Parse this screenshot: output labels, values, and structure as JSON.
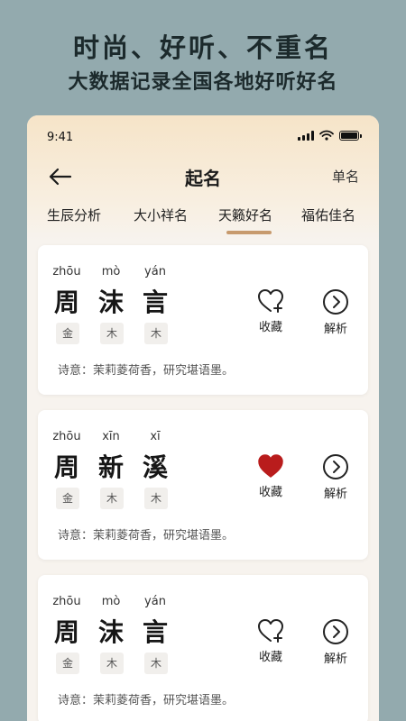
{
  "promo": {
    "title": "时尚、好听、不重名",
    "subtitle": "大数据记录全国各地好听好名"
  },
  "status_bar": {
    "time": "9:41"
  },
  "nav": {
    "title": "起名",
    "right_label": "单名"
  },
  "tabs": [
    {
      "label": "生辰分析"
    },
    {
      "label": "大小祥名"
    },
    {
      "label": "天籁好名",
      "active": true
    },
    {
      "label": "福佑佳名"
    }
  ],
  "colors": {
    "accent": "#c79a6d",
    "favorite_active": "#b91c1c"
  },
  "names": [
    {
      "chars": [
        {
          "pinyin": "zhōu",
          "hanzi": "周",
          "element": "金"
        },
        {
          "pinyin": "mò",
          "hanzi": "沫",
          "element": "木"
        },
        {
          "pinyin": "yán",
          "hanzi": "言",
          "element": "木"
        }
      ],
      "poem": "诗意：茉莉菱荷香，研究堪语墨。",
      "favorite_label": "收藏",
      "favorited": false,
      "analyze_label": "解析"
    },
    {
      "chars": [
        {
          "pinyin": "zhōu",
          "hanzi": "周",
          "element": "金"
        },
        {
          "pinyin": "xīn",
          "hanzi": "新",
          "element": "木"
        },
        {
          "pinyin": "xī",
          "hanzi": "溪",
          "element": "木"
        }
      ],
      "poem": "诗意：茉莉菱荷香，研究堪语墨。",
      "favorite_label": "收藏",
      "favorited": true,
      "analyze_label": "解析"
    },
    {
      "chars": [
        {
          "pinyin": "zhōu",
          "hanzi": "周",
          "element": "金"
        },
        {
          "pinyin": "mò",
          "hanzi": "沫",
          "element": "木"
        },
        {
          "pinyin": "yán",
          "hanzi": "言",
          "element": "木"
        }
      ],
      "poem": "诗意：茉莉菱荷香，研究堪语墨。",
      "favorite_label": "收藏",
      "favorited": false,
      "analyze_label": "解析"
    }
  ]
}
